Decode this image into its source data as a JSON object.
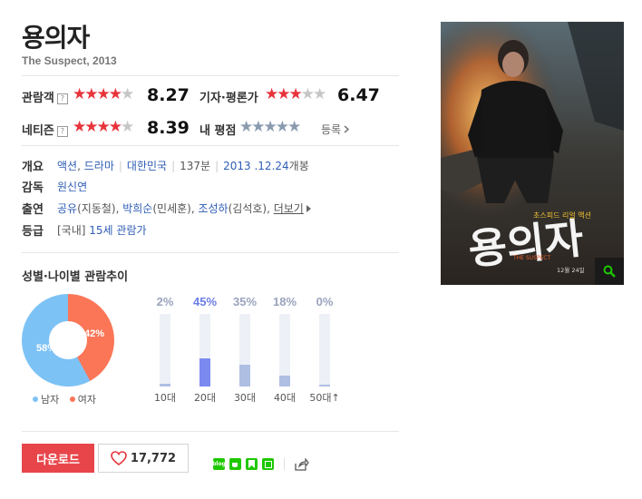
{
  "movie": {
    "title": "용의자",
    "subtitle": "The Suspect, 2013"
  },
  "ratings": {
    "audience": {
      "label": "관람객",
      "help": "?",
      "score": "8.27",
      "stars_filled": 4
    },
    "critics": {
      "label": "기자·평론가",
      "score": "6.47",
      "stars_filled": 3
    },
    "netizen": {
      "label": "네티즌",
      "help": "?",
      "score": "8.39",
      "stars_filled": 4
    },
    "mine": {
      "label": "내 평점",
      "register": "등록"
    }
  },
  "info": {
    "overview_label": "개요",
    "genre1": "액션",
    "genre2": "드라마",
    "country": "대한민국",
    "runtime": "137분",
    "release_date": "2013 .12.24",
    "release_suffix": "개봉",
    "director_label": "감독",
    "director": "원신연",
    "cast_label": "출연",
    "cast1": "공유",
    "cast1_role": "(지동철)",
    "cast2": "박희순",
    "cast2_role": "(민세훈)",
    "cast3": "조성하",
    "cast3_role": "(김석호)",
    "more": "더보기",
    "grade_label": "등급",
    "grade_prefix": "[국내]",
    "grade": "15세 관람가"
  },
  "trend": {
    "title": "성별·나이별 관람추이",
    "gender": {
      "male_pct": 58,
      "male_label": "58%",
      "female_pct": 42,
      "female_label": "42%",
      "male_legend": "남자",
      "female_legend": "여자",
      "male_color": "#7cc2f5",
      "female_color": "#fb7657"
    },
    "ages": [
      {
        "cat": "10대",
        "pct": 2,
        "label": "2%"
      },
      {
        "cat": "20대",
        "pct": 45,
        "label": "45%",
        "highlight": true
      },
      {
        "cat": "30대",
        "pct": 35,
        "label": "35%"
      },
      {
        "cat": "40대",
        "pct": 18,
        "label": "18%"
      },
      {
        "cat": "50대↑",
        "pct": 0,
        "label": "0%"
      }
    ]
  },
  "actions": {
    "download": "다운로드",
    "likes": "17,772",
    "share_icons": [
      "blog-icon",
      "cafe-icon",
      "bookmark-icon",
      "memo-icon",
      "share-icon"
    ]
  },
  "poster": {
    "title_art": "용의자",
    "tagline": "초스피드 리얼 액션",
    "caption": "THE SUSPECT",
    "release": "12월 24일"
  }
}
